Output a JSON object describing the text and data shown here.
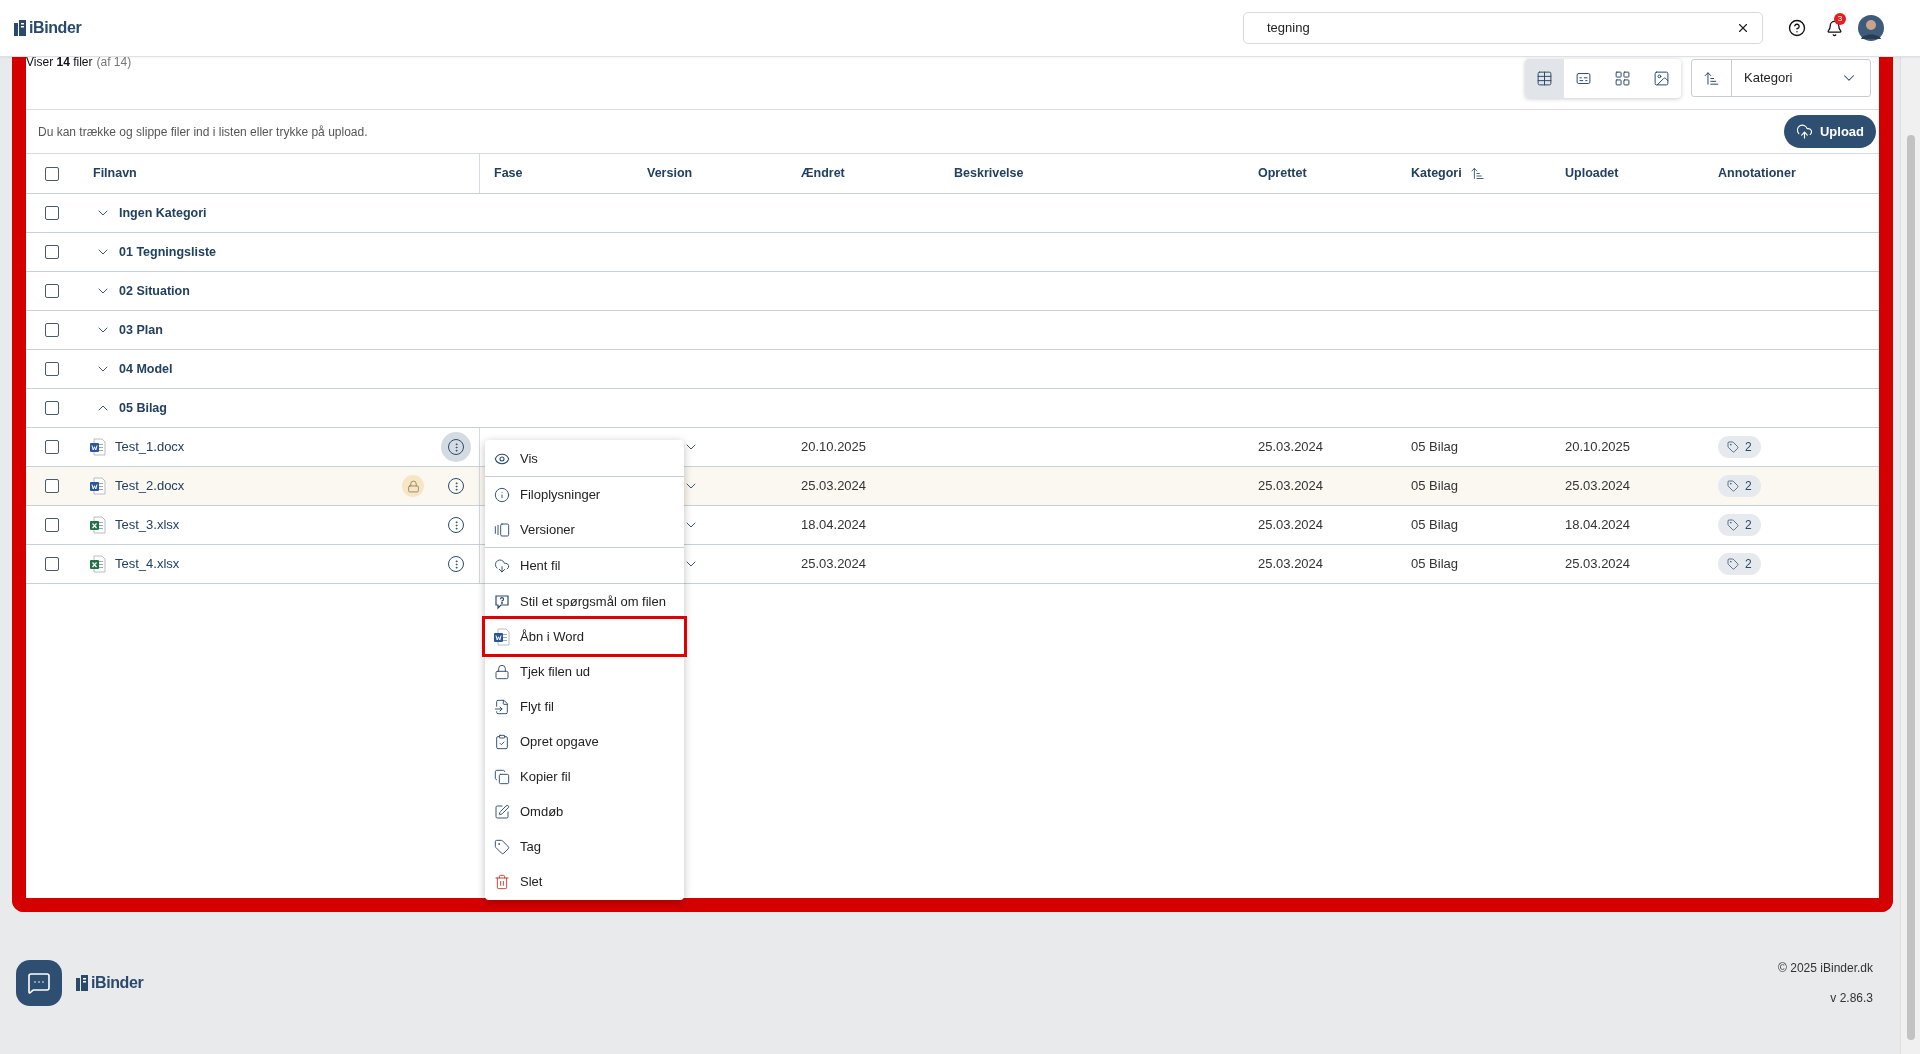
{
  "header": {
    "logo": "iBinder",
    "search": {
      "value": "tegning"
    },
    "notifications": "3"
  },
  "toolbar": {
    "summary": "Viser **14** filer",
    "summary_total": "(af 14)",
    "views": [
      {
        "selected": true
      },
      {
        "selected": false
      },
      {
        "selected": false
      },
      {
        "selected": false
      }
    ],
    "sort": {
      "value": "Kategori"
    },
    "hint": "Du kan trække og slippe filer ind i listen eller trykke på upload.",
    "upload": "Upload"
  },
  "table": {
    "checked": false,
    "columns": [
      {
        "label": "Filnavn",
        "sorted": false
      },
      {
        "label": "Fase",
        "sorted": false
      },
      {
        "label": "Version",
        "sorted": false
      },
      {
        "label": "Ændret",
        "sorted": false
      },
      {
        "label": "Beskrivelse",
        "sorted": false
      },
      {
        "label": "Oprettet",
        "sorted": false
      },
      {
        "label": "Kategori",
        "sorted": true
      },
      {
        "label": "Uploadet",
        "sorted": false
      },
      {
        "label": "Annotationer",
        "sorted": false
      }
    ],
    "groups": [
      {
        "label": "Ingen Kategori",
        "checked": false,
        "expanded": false
      },
      {
        "label": "01 Tegningsliste",
        "checked": false,
        "expanded": false
      },
      {
        "label": "02 Situation",
        "checked": false,
        "expanded": false
      },
      {
        "label": "03 Plan",
        "checked": false,
        "expanded": false
      },
      {
        "label": "04 Model",
        "checked": false,
        "expanded": false
      },
      {
        "label": "05 Bilag",
        "checked": false,
        "expanded": true,
        "files": [
          {
            "name": "Test_1.docx",
            "kind": "word",
            "checked": false,
            "locked": false,
            "menu_open": true,
            "changed": "20.10.2025",
            "created": "25.03.2024",
            "category": "05 Bilag",
            "uploaded": "20.10.2025",
            "annotations": "2"
          },
          {
            "name": "Test_2.docx",
            "kind": "word",
            "checked": false,
            "locked": true,
            "menu_open": false,
            "changed": "25.03.2024",
            "created": "25.03.2024",
            "category": "05 Bilag",
            "uploaded": "25.03.2024",
            "annotations": "2"
          },
          {
            "name": "Test_3.xlsx",
            "kind": "excel",
            "checked": false,
            "locked": false,
            "menu_open": false,
            "changed": "18.04.2024",
            "created": "25.03.2024",
            "category": "05 Bilag",
            "uploaded": "18.04.2024",
            "annotations": "2"
          },
          {
            "name": "Test_4.xlsx",
            "kind": "excel",
            "checked": false,
            "locked": false,
            "menu_open": false,
            "changed": "25.03.2024",
            "created": "25.03.2024",
            "category": "05 Bilag",
            "uploaded": "25.03.2024",
            "annotations": "2"
          }
        ]
      }
    ]
  },
  "menu": {
    "sections": [
      [
        {
          "label": "Vis",
          "highlighted": false,
          "kind": "normal"
        }
      ],
      [
        {
          "label": "Filoplysninger",
          "highlighted": false,
          "kind": "normal"
        },
        {
          "label": "Versioner",
          "highlighted": false,
          "kind": "normal"
        }
      ],
      [
        {
          "label": "Hent fil",
          "highlighted": false,
          "kind": "normal"
        }
      ],
      [
        {
          "label": "Stil et spørgsmål om filen",
          "highlighted": false,
          "kind": "normal"
        },
        {
          "label": "Åbn i Word",
          "highlighted": true,
          "kind": "normal"
        },
        {
          "label": "Tjek filen ud",
          "highlighted": false,
          "kind": "normal"
        },
        {
          "label": "Flyt fil",
          "highlighted": false,
          "kind": "normal"
        },
        {
          "label": "Opret opgave",
          "highlighted": false,
          "kind": "normal"
        },
        {
          "label": "Kopier fil",
          "highlighted": false,
          "kind": "normal"
        },
        {
          "label": "Omdøb",
          "highlighted": false,
          "kind": "normal"
        },
        {
          "label": "Tag",
          "highlighted": false,
          "kind": "normal"
        },
        {
          "label": "Slet",
          "highlighted": false,
          "kind": "danger"
        }
      ]
    ]
  },
  "footer": {
    "logo": "iBinder",
    "copyright": "© 2025 iBinder.dk",
    "version": "v 2.86.3"
  }
}
